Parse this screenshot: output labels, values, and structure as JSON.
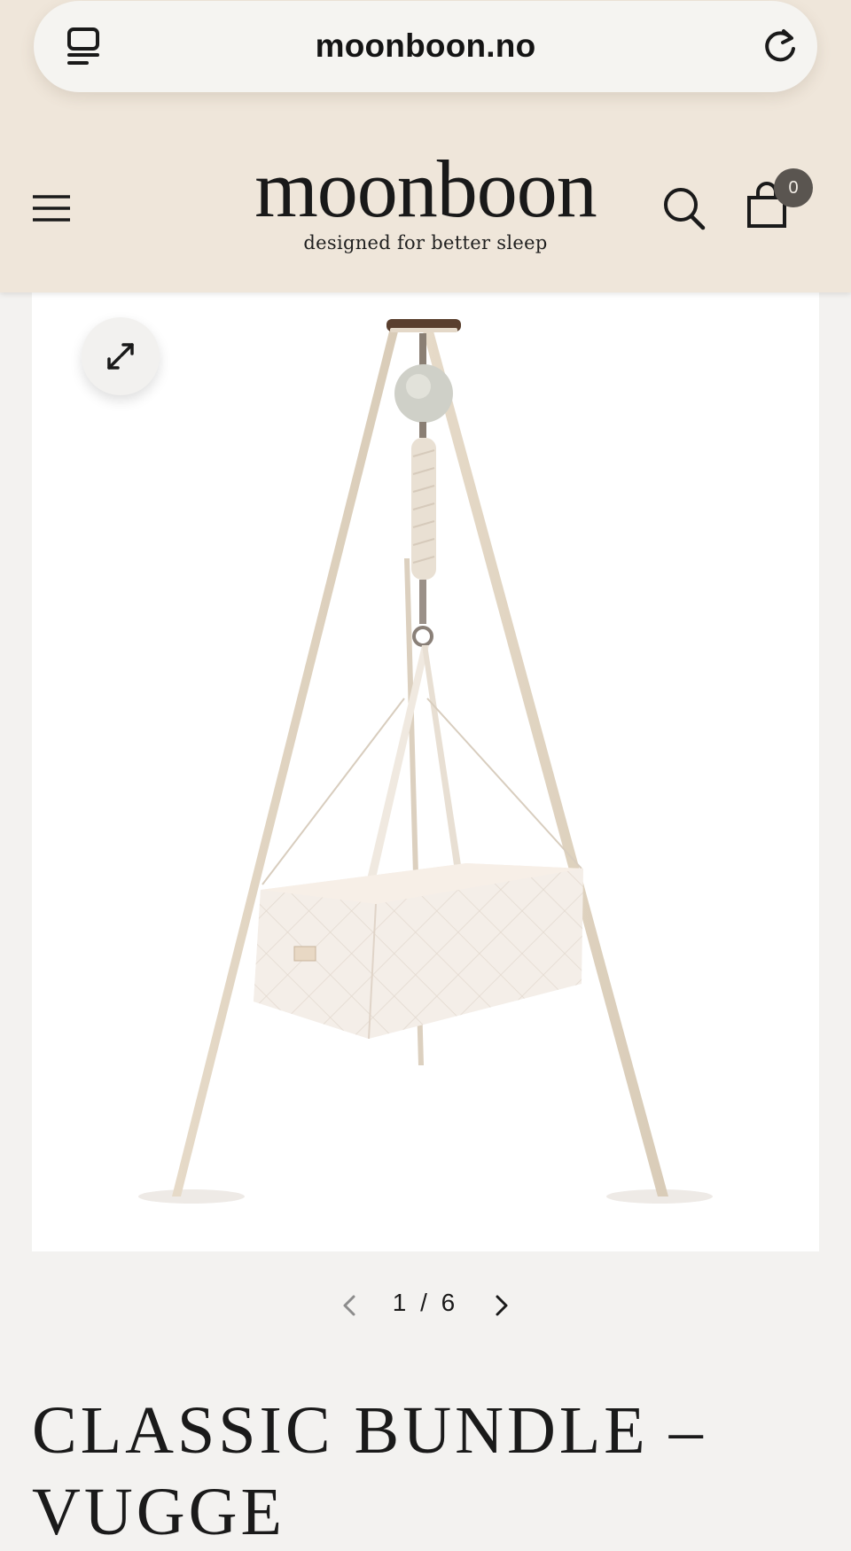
{
  "browser": {
    "url": "moonboon.no",
    "icons": {
      "tabs": "tabs-icon",
      "reload": "reload-icon"
    }
  },
  "header": {
    "logo": "moonboon",
    "tagline": "designed for better sleep",
    "cart_count": "0",
    "icons": {
      "menu": "hamburger-menu-icon",
      "search": "search-icon",
      "cart": "shopping-bag-icon"
    }
  },
  "gallery": {
    "current": "1",
    "separator": "/",
    "total": "6",
    "icons": {
      "expand": "expand-icon",
      "prev": "chevron-left-icon",
      "next": "chevron-right-icon"
    }
  },
  "product": {
    "title": "CLASSIC BUNDLE – VUGGE"
  },
  "colors": {
    "header_bg": "#efe6da",
    "page_bg": "#f3f2f0",
    "badge_bg": "#5a5550",
    "frame_cream": "#e9dfd0"
  }
}
